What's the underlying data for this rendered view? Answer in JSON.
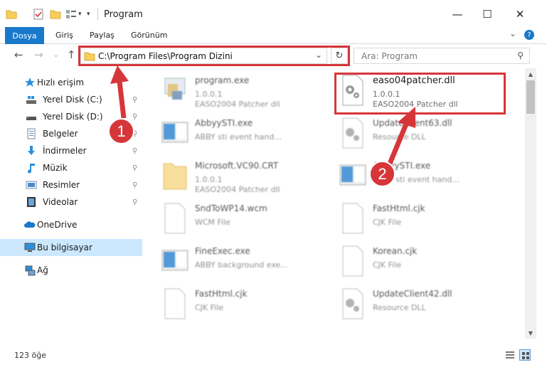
{
  "window": {
    "title": "Program",
    "minimize": "—",
    "maximize": "☐",
    "close": "✕"
  },
  "ribbon": {
    "tabs": [
      "Dosya",
      "Giriş",
      "Paylaş",
      "Görünüm"
    ],
    "expand": "⌄",
    "help": "?"
  },
  "nav": {
    "back": "←",
    "forward": "→",
    "recent": "⌄",
    "up": "↑",
    "address": "C:\\Program Files\\Program Dizini",
    "address_dropdown": "⌄",
    "refresh": "↻",
    "search_placeholder": "Ara: Program",
    "search_icon": "⚲"
  },
  "sidebar": {
    "items": [
      {
        "label": "Hızlı erişim",
        "icon": "star-icon",
        "pinned": false
      },
      {
        "label": "Yerel Disk (C:)",
        "icon": "drive-icon",
        "pinned": true
      },
      {
        "label": "Yerel Disk (D:)",
        "icon": "drive-icon",
        "pinned": true
      },
      {
        "label": "Belgeler",
        "icon": "documents-icon",
        "pinned": true
      },
      {
        "label": "İndirmeler",
        "icon": "download-icon",
        "pinned": true
      },
      {
        "label": "Müzik",
        "icon": "music-icon",
        "pinned": true
      },
      {
        "label": "Resimler",
        "icon": "pictures-icon",
        "pinned": true
      },
      {
        "label": "Videolar",
        "icon": "videos-icon",
        "pinned": true
      },
      {
        "label": "OneDrive",
        "icon": "cloud-icon",
        "pinned": false
      },
      {
        "label": "Bu bilgisayar",
        "icon": "computer-icon",
        "pinned": false
      },
      {
        "label": "Ağ",
        "icon": "network-icon",
        "pinned": false
      }
    ],
    "pin_glyph": "📌"
  },
  "files": {
    "col1": [
      {
        "name": "program.exe",
        "line2": "1.0.0.1",
        "line3": "EASO2004 Patcher dll",
        "icon": "exe-icon"
      },
      {
        "name": "AbbyySTI.exe",
        "line2": "ABBY sti event hand...",
        "line3": "",
        "icon": "app-window-icon"
      },
      {
        "name": "Microsoft.VC90.CRT",
        "line2": "1.0.0.1",
        "line3": "EASO2004 Patcher dll",
        "icon": "folder-icon"
      },
      {
        "name": "SndToWP14.wcm",
        "line2": "WCM File",
        "line3": "",
        "icon": "file-icon"
      },
      {
        "name": "FineExec.exe",
        "line2": "ABBY background exe...",
        "line3": "",
        "icon": "app-window-icon"
      },
      {
        "name": "FastHtml.cjk",
        "line2": "CJK File",
        "line3": "",
        "icon": "file-icon"
      }
    ],
    "col2": [
      {
        "name": "easo04patcher.dll",
        "line2": "1.0.0.1",
        "line3": "EASO2004 Patcher dll",
        "icon": "dll-gear-icon"
      },
      {
        "name": "UpdateClient63.dll",
        "line2": "Resource DLL",
        "line3": "",
        "icon": "dll-gear-icon"
      },
      {
        "name": "AbbyySTI.exe",
        "line2": "ABBY sti event hand...",
        "line3": "",
        "icon": "app-window-icon"
      },
      {
        "name": "FastHtml.cjk",
        "line2": "CJK File",
        "line3": "",
        "icon": "file-icon"
      },
      {
        "name": "Korean.cjk",
        "line2": "CJK File",
        "line3": "",
        "icon": "file-icon"
      },
      {
        "name": "UpdateClient42.dll",
        "line2": "Resource DLL",
        "line3": "",
        "icon": "dll-gear-icon"
      }
    ]
  },
  "status": {
    "count": "123 öğe"
  },
  "annotations": {
    "step1": "1",
    "step2": "2",
    "color": "#d6363a"
  }
}
